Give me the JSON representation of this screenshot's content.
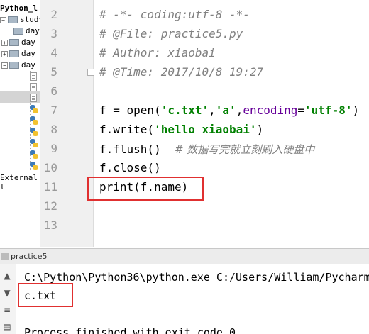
{
  "project_panel": {
    "root_label": "Python_l",
    "items": [
      {
        "label": "study",
        "type": "folder"
      },
      {
        "label": "day",
        "type": "folder"
      },
      {
        "label": "day",
        "type": "folder"
      },
      {
        "label": "day",
        "type": "folder"
      },
      {
        "label": "day",
        "type": "folder"
      }
    ],
    "external_label": "External l"
  },
  "editor": {
    "lines": [
      {
        "num": "2",
        "text": "# -*- coding:utf-8 -*-"
      },
      {
        "num": "3",
        "text": "# @File: practice5.py"
      },
      {
        "num": "4",
        "text": "# Author: xiaobai"
      },
      {
        "num": "5",
        "text": "# @Time: 2017/10/8 19:27"
      },
      {
        "num": "6",
        "text": ""
      },
      {
        "num": "7",
        "text": "f = open('c.txt','a',encoding='utf-8')"
      },
      {
        "num": "8",
        "text": "f.write('hello xiaobai')"
      },
      {
        "num": "9",
        "text": "f.flush()  # 数据写完就立刻刷入硬盘中"
      },
      {
        "num": "10",
        "text": "f.close()"
      },
      {
        "num": "11",
        "text": "print(f.name)"
      },
      {
        "num": "12",
        "text": ""
      },
      {
        "num": "13",
        "text": ""
      }
    ],
    "line7_parts": {
      "a": "f = open(",
      "s1": "'c.txt'",
      "b": ",",
      "s2": "'a'",
      "c": ",",
      "p": "encoding",
      "d": "=",
      "s3": "'utf-8'",
      "e": ")"
    },
    "line8_parts": {
      "a": "f.write(",
      "s": "'hello xiaobai'",
      "b": ")"
    },
    "line9_parts": {
      "a": "f.flush()  ",
      "c": "# 数据写完就立刻刷入硬盘中"
    }
  },
  "run_panel": {
    "tab_label": "practice5",
    "console_lines": [
      "C:\\Python\\Python36\\python.exe C:/Users/William/Pycharm",
      "c.txt",
      "",
      "Process finished with exit code 0"
    ]
  },
  "colors": {
    "highlight_box": "#e03030",
    "string": "#008000",
    "comment": "#808080",
    "param": "#660099"
  }
}
